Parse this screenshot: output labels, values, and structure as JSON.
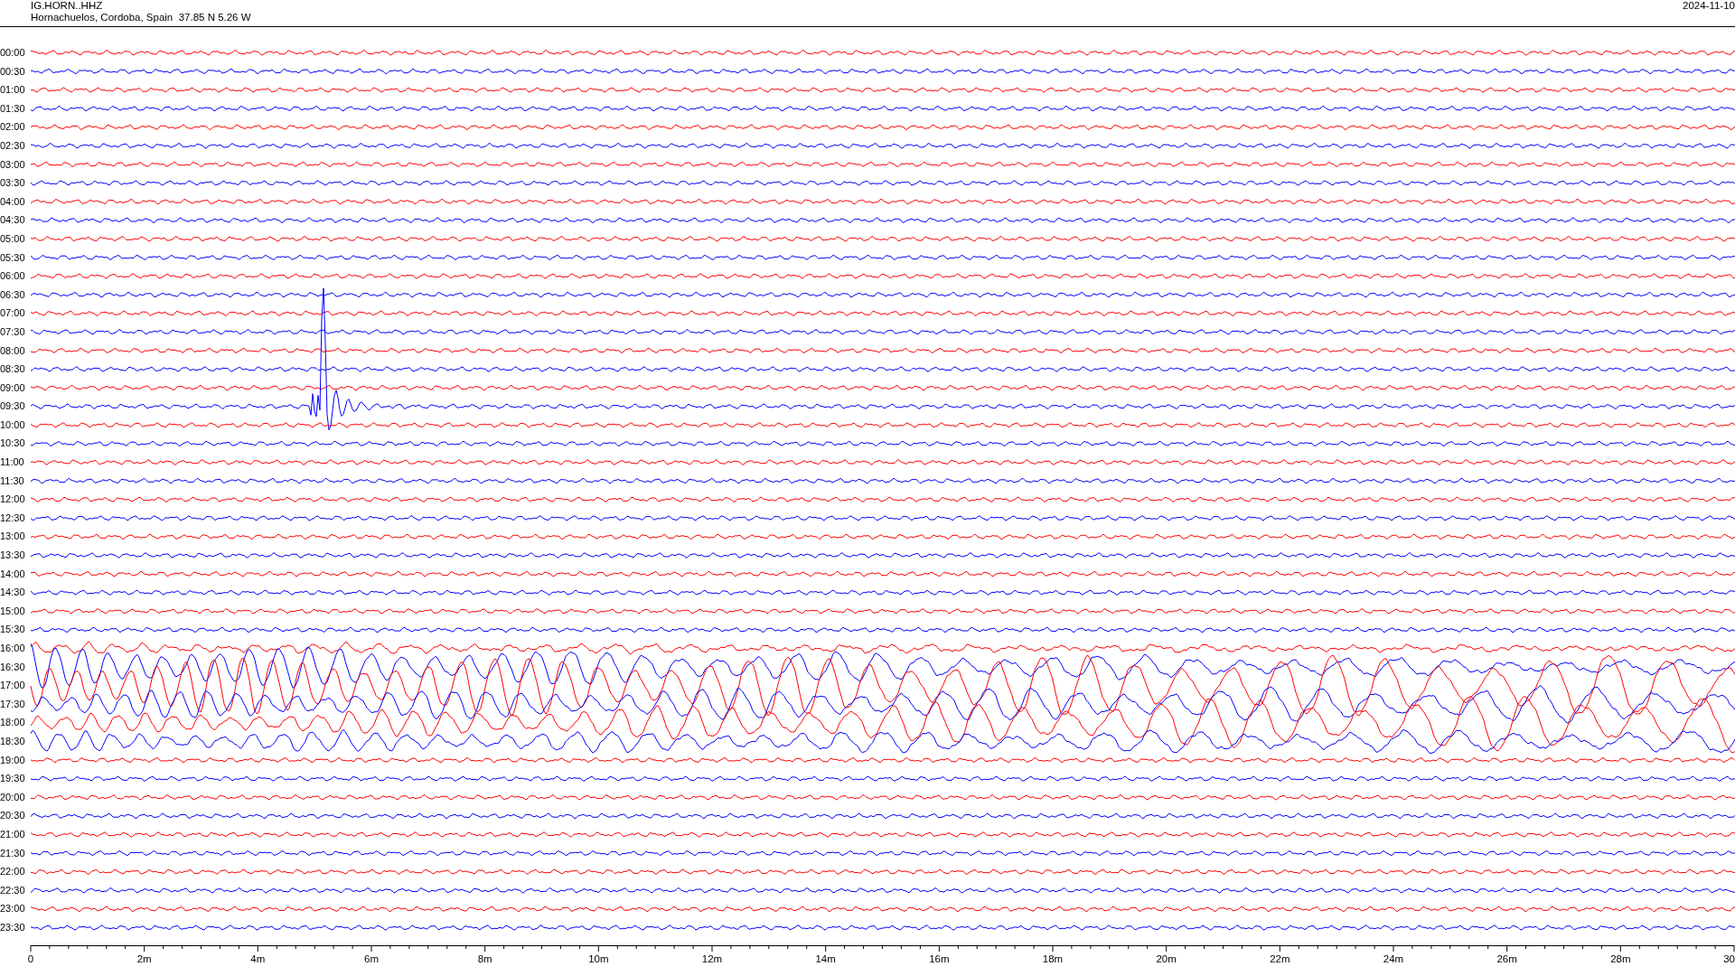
{
  "station": {
    "code": "IG.HORN..HHZ",
    "location": "Hornachuelos, Cordoba, Spain  37.85 N 5.26 W"
  },
  "date": "2024-11-10",
  "rows": [
    {
      "time": "00:00",
      "color": "#ff0000",
      "kind": "noise"
    },
    {
      "time": "00:30",
      "color": "#0000ff",
      "kind": "noise"
    },
    {
      "time": "01:00",
      "color": "#ff0000",
      "kind": "noise"
    },
    {
      "time": "01:30",
      "color": "#0000ff",
      "kind": "noise"
    },
    {
      "time": "02:00",
      "color": "#ff0000",
      "kind": "noise"
    },
    {
      "time": "02:30",
      "color": "#0000ff",
      "kind": "noise"
    },
    {
      "time": "03:00",
      "color": "#ff0000",
      "kind": "noise"
    },
    {
      "time": "03:30",
      "color": "#0000ff",
      "kind": "noise"
    },
    {
      "time": "04:00",
      "color": "#ff0000",
      "kind": "noise"
    },
    {
      "time": "04:30",
      "color": "#0000ff",
      "kind": "noise"
    },
    {
      "time": "05:00",
      "color": "#ff0000",
      "kind": "noise"
    },
    {
      "time": "05:30",
      "color": "#0000ff",
      "kind": "noise"
    },
    {
      "time": "06:00",
      "color": "#ff0000",
      "kind": "noise"
    },
    {
      "time": "06:30",
      "color": "#0000ff",
      "kind": "noise"
    },
    {
      "time": "07:00",
      "color": "#ff0000",
      "kind": "noise"
    },
    {
      "time": "07:30",
      "color": "#0000ff",
      "kind": "noise"
    },
    {
      "time": "08:00",
      "color": "#ff0000",
      "kind": "noise"
    },
    {
      "time": "08:30",
      "color": "#0000ff",
      "kind": "noise"
    },
    {
      "time": "09:00",
      "color": "#ff0000",
      "kind": "noise"
    },
    {
      "time": "09:30",
      "color": "#0000ff",
      "kind": "quake"
    },
    {
      "time": "10:00",
      "color": "#ff0000",
      "kind": "noise"
    },
    {
      "time": "10:30",
      "color": "#0000ff",
      "kind": "noise"
    },
    {
      "time": "11:00",
      "color": "#ff0000",
      "kind": "noise"
    },
    {
      "time": "11:30",
      "color": "#0000ff",
      "kind": "noise"
    },
    {
      "time": "12:00",
      "color": "#ff0000",
      "kind": "noise"
    },
    {
      "time": "12:30",
      "color": "#0000ff",
      "kind": "noise"
    },
    {
      "time": "13:00",
      "color": "#ff0000",
      "kind": "noise"
    },
    {
      "time": "13:30",
      "color": "#0000ff",
      "kind": "noise"
    },
    {
      "time": "14:00",
      "color": "#ff0000",
      "kind": "noise"
    },
    {
      "time": "14:30",
      "color": "#0000ff",
      "kind": "noise"
    },
    {
      "time": "15:00",
      "color": "#ff0000",
      "kind": "noise"
    },
    {
      "time": "15:30",
      "color": "#0000ff",
      "kind": "noise"
    },
    {
      "time": "16:00",
      "color": "#ff0000",
      "kind": "surface"
    },
    {
      "time": "16:30",
      "color": "#0000ff",
      "kind": "surface"
    },
    {
      "time": "17:00",
      "color": "#ff0000",
      "kind": "surface"
    },
    {
      "time": "17:30",
      "color": "#0000ff",
      "kind": "surface"
    },
    {
      "time": "18:00",
      "color": "#ff0000",
      "kind": "surface"
    },
    {
      "time": "18:30",
      "color": "#0000ff",
      "kind": "surface"
    },
    {
      "time": "19:00",
      "color": "#ff0000",
      "kind": "noise"
    },
    {
      "time": "19:30",
      "color": "#0000ff",
      "kind": "noise"
    },
    {
      "time": "20:00",
      "color": "#ff0000",
      "kind": "noise"
    },
    {
      "time": "20:30",
      "color": "#0000ff",
      "kind": "noise"
    },
    {
      "time": "21:00",
      "color": "#ff0000",
      "kind": "noise"
    },
    {
      "time": "21:30",
      "color": "#0000ff",
      "kind": "noise"
    },
    {
      "time": "22:00",
      "color": "#ff0000",
      "kind": "noise"
    },
    {
      "time": "22:30",
      "color": "#0000ff",
      "kind": "noise"
    },
    {
      "time": "23:00",
      "color": "#ff0000",
      "kind": "noise"
    },
    {
      "time": "23:30",
      "color": "#0000ff",
      "kind": "noise"
    }
  ],
  "axis": {
    "ticks": [
      "0",
      "2m",
      "4m",
      "6m",
      "8m",
      "10m",
      "12m",
      "14m",
      "16m",
      "18m",
      "20m",
      "22m",
      "24m",
      "26m",
      "28m",
      "30"
    ]
  }
}
